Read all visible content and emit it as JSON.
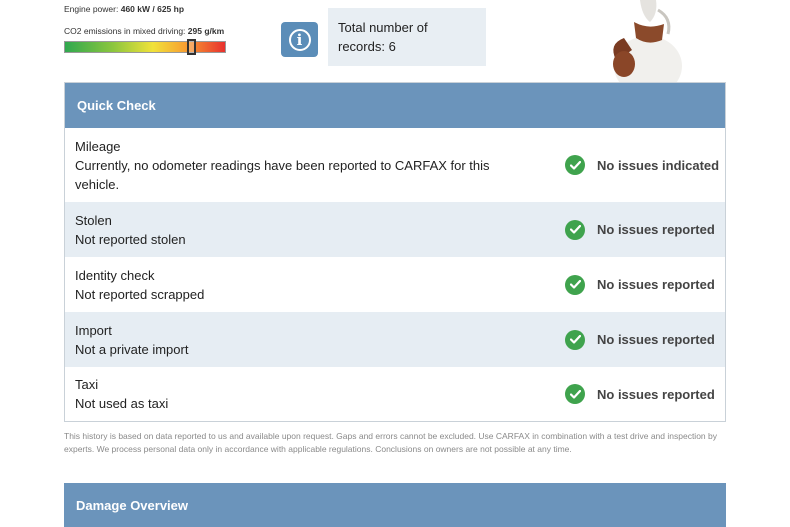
{
  "specs": {
    "power_label": "Engine power:",
    "power_value": "460 kW / 625 hp",
    "co2_label": "CO2 emissions in mixed driving:",
    "co2_value": "295 g/km",
    "co2_level_fraction": 0.81,
    "co2_bar_colors": [
      "#2fa84f",
      "#8cc63e",
      "#f1e23a",
      "#f7a032",
      "#e8302e"
    ]
  },
  "records": {
    "info_icon": "info-icon",
    "text": "Total number of records: 6"
  },
  "mascot": {
    "icon": "fox-mascot"
  },
  "quick_check": {
    "title": "Quick Check",
    "status_color": "#3fa34d",
    "header_color": "#6b94bb",
    "rows": [
      {
        "title": "Mileage",
        "description": "Currently, no odometer readings have been reported to CARFAX for this vehicle.",
        "status": "No issues indicated",
        "icon": "check-circle-icon"
      },
      {
        "title": "Stolen",
        "description": "Not reported stolen",
        "status": "No issues reported",
        "icon": "check-circle-icon"
      },
      {
        "title": "Identity check",
        "description": "Not reported scrapped",
        "status": "No issues reported",
        "icon": "check-circle-icon"
      },
      {
        "title": "Import",
        "description": "Not a private import",
        "status": "No issues reported",
        "icon": "check-circle-icon"
      },
      {
        "title": "Taxi",
        "description": "Not used as taxi",
        "status": "No issues reported",
        "icon": "check-circle-icon"
      }
    ]
  },
  "disclaimer": "This history is based on data reported to us and available upon request. Gaps and errors cannot be excluded. Use CARFAX in combination with a test drive and inspection by experts. We process personal data only in accordance with applicable regulations. Conclusions on owners are not possible at any time.",
  "damage_overview": {
    "title": "Damage Overview"
  }
}
